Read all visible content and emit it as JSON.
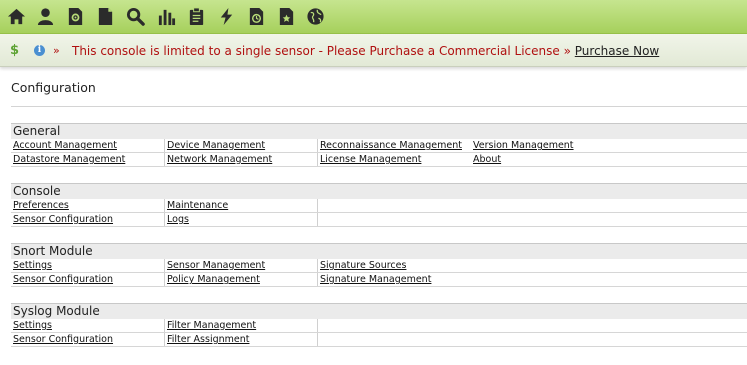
{
  "toolbar": {
    "icons": [
      "home-icon",
      "user-icon",
      "settings-file-icon",
      "document-icon",
      "search-icon",
      "bar-chart-icon",
      "clipboard-icon",
      "lightning-icon",
      "clock-file-icon",
      "star-file-icon",
      "globe-icon"
    ]
  },
  "banner": {
    "dollar": "$",
    "info": "i",
    "prefix": "»",
    "message": "This console is limited to a single sensor - Please Purchase a Commercial License",
    "suffix": "»",
    "link": "Purchase Now"
  },
  "page": {
    "title": "Configuration"
  },
  "sections": [
    {
      "title": "General",
      "rows": [
        [
          "Account Management",
          "Device Management",
          "Reconnaissance Management",
          "Version Management"
        ],
        [
          "Datastore Management",
          "Network Management",
          "License Management",
          "About"
        ]
      ]
    },
    {
      "title": "Console",
      "rows": [
        [
          "Preferences",
          "Maintenance"
        ],
        [
          "Sensor Configuration",
          "Logs"
        ]
      ]
    },
    {
      "title": "Snort Module",
      "rows": [
        [
          "Settings",
          "Sensor Management",
          "Signature Sources"
        ],
        [
          "Sensor Configuration",
          "Policy Management",
          "Signature Management"
        ]
      ]
    },
    {
      "title": "Syslog Module",
      "rows": [
        [
          "Settings",
          "Filter Management"
        ],
        [
          "Sensor Configuration",
          "Filter Assignment"
        ]
      ]
    }
  ]
}
